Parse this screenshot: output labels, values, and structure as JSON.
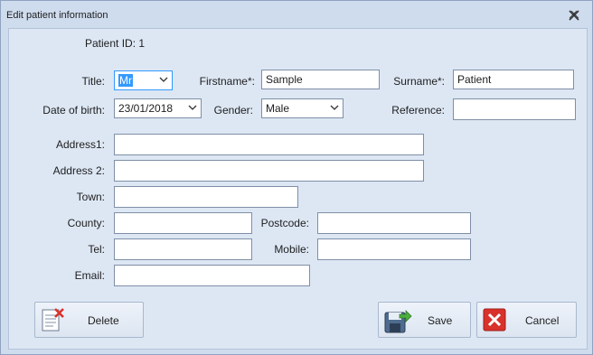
{
  "window": {
    "title": "Edit patient information"
  },
  "patient_id": "Patient ID: 1",
  "labels": {
    "title": "Title:",
    "firstname": "Firstname*:",
    "surname": "Surname*:",
    "dob": "Date of birth:",
    "gender": "Gender:",
    "reference": "Reference:",
    "address1": "Address1:",
    "address2": "Address 2:",
    "town": "Town:",
    "county": "County:",
    "postcode": "Postcode:",
    "tel": "Tel:",
    "mobile": "Mobile:",
    "email": "Email:"
  },
  "fields": {
    "title": "Mr",
    "firstname": "Sample",
    "surname": "Patient",
    "dob": "23/01/2018",
    "gender": "Male",
    "reference": "",
    "address1": "",
    "address2": "",
    "town": "",
    "county": "",
    "postcode": "",
    "tel": "",
    "mobile": "",
    "email": ""
  },
  "buttons": {
    "delete": "Delete",
    "save": "Save",
    "cancel": "Cancel"
  },
  "icons": {
    "close": "close-icon",
    "delete": "delete-document-icon",
    "save": "save-disk-icon",
    "cancel": "cancel-x-icon"
  },
  "colors": {
    "accent": "#3399ff",
    "cancel_red": "#d9312b",
    "window_bg": "#dde7f4"
  }
}
